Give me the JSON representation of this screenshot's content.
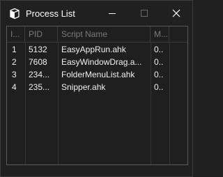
{
  "window": {
    "title": "Process List",
    "app_icon": "app-cube-icon",
    "controls": {
      "minimize": "minimize-icon",
      "maximize": "maximize-icon",
      "close": "close-icon"
    }
  },
  "list": {
    "columns": [
      "I...",
      "PID",
      "Script Name",
      "M..."
    ],
    "rows": [
      {
        "index": "1",
        "pid": "5132",
        "name": "EasyAppRun.ahk",
        "mem": "0.."
      },
      {
        "index": "2",
        "pid": "7608",
        "name": "EasyWindowDrag.a...",
        "mem": "0.."
      },
      {
        "index": "3",
        "pid": "234...",
        "name": "FolderMenuList.ahk",
        "mem": "0.."
      },
      {
        "index": "4",
        "pid": "235...",
        "name": "Snipper.ahk",
        "mem": "0.."
      }
    ]
  },
  "colors": {
    "background": "#202020",
    "text": "#f0f0f0",
    "header_text": "#7a7a7a",
    "grid": "#3c3c3c",
    "border": "#5a5a5a"
  }
}
